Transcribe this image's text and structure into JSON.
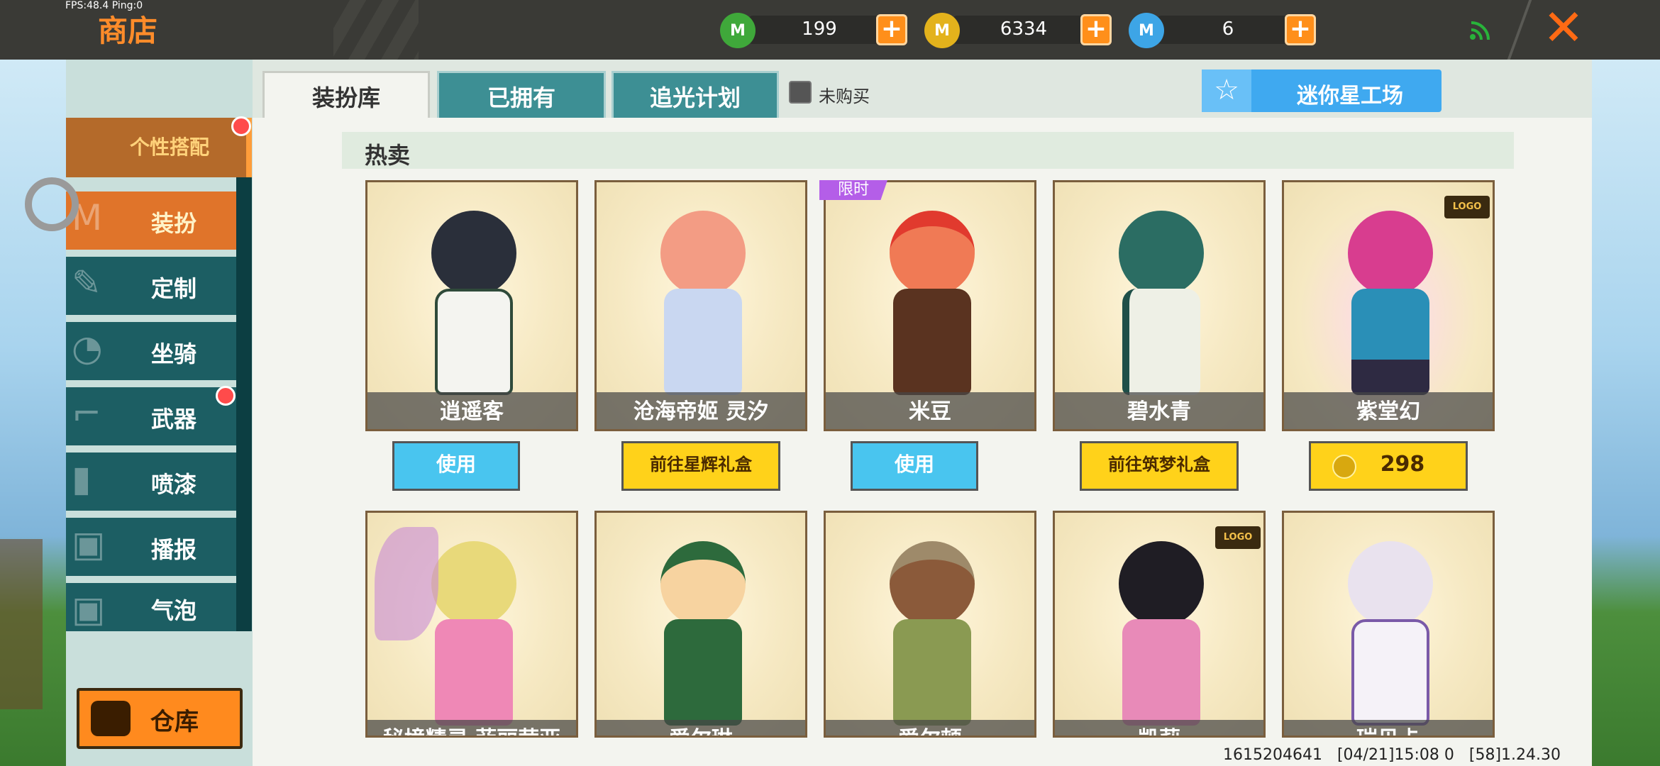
{
  "status": {
    "fps": "FPS:48.4  Ping:0"
  },
  "header": {
    "title": "商店",
    "currencies": [
      {
        "name": "green-gem",
        "value": "199",
        "color": "#3fa83a"
      },
      {
        "name": "gold-coin",
        "value": "6334",
        "color": "#e3b21c"
      },
      {
        "name": "blue-star",
        "value": "6",
        "color": "#3da5e6"
      }
    ]
  },
  "sidebar": {
    "category": "个性搭配",
    "items": [
      {
        "label": "装扮",
        "icon": "shirt-icon",
        "active": true
      },
      {
        "label": "定制",
        "icon": "pencil-icon"
      },
      {
        "label": "坐骑",
        "icon": "saddle-icon"
      },
      {
        "label": "武器",
        "icon": "gun-icon",
        "dot": true
      },
      {
        "label": "喷漆",
        "icon": "spray-can-icon"
      },
      {
        "label": "播报",
        "icon": "broadcast-icon"
      },
      {
        "label": "气泡",
        "icon": "bubble-icon"
      }
    ],
    "warehouse": "仓库"
  },
  "tabs": [
    {
      "label": "装扮库",
      "active": true
    },
    {
      "label": "已拥有"
    },
    {
      "label": "追光计划"
    }
  ],
  "filter": {
    "label": "未购买"
  },
  "studio_button": "迷你星工场",
  "section": {
    "title": "热卖"
  },
  "items_row1": [
    {
      "name": "逍遥客",
      "action": "使用",
      "type": "use"
    },
    {
      "name": "沧海帝姬 灵汐",
      "action": "前往星辉礼盒",
      "type": "go"
    },
    {
      "name": "米豆",
      "action": "使用",
      "type": "use",
      "badge": "限时"
    },
    {
      "name": "碧水青",
      "action": "前往筑梦礼盒",
      "type": "go"
    },
    {
      "name": "紫堂幻",
      "action": "298",
      "type": "price"
    }
  ],
  "items_row2": [
    {
      "name": "秘境精灵 菲丽茜亚"
    },
    {
      "name": "爱尔琳"
    },
    {
      "name": "爱尔顿"
    },
    {
      "name": "凯莉"
    },
    {
      "name": "瑞贝卡"
    }
  ],
  "footer": "1615204641   [04/21]15:08 0   [58]1.24.30"
}
